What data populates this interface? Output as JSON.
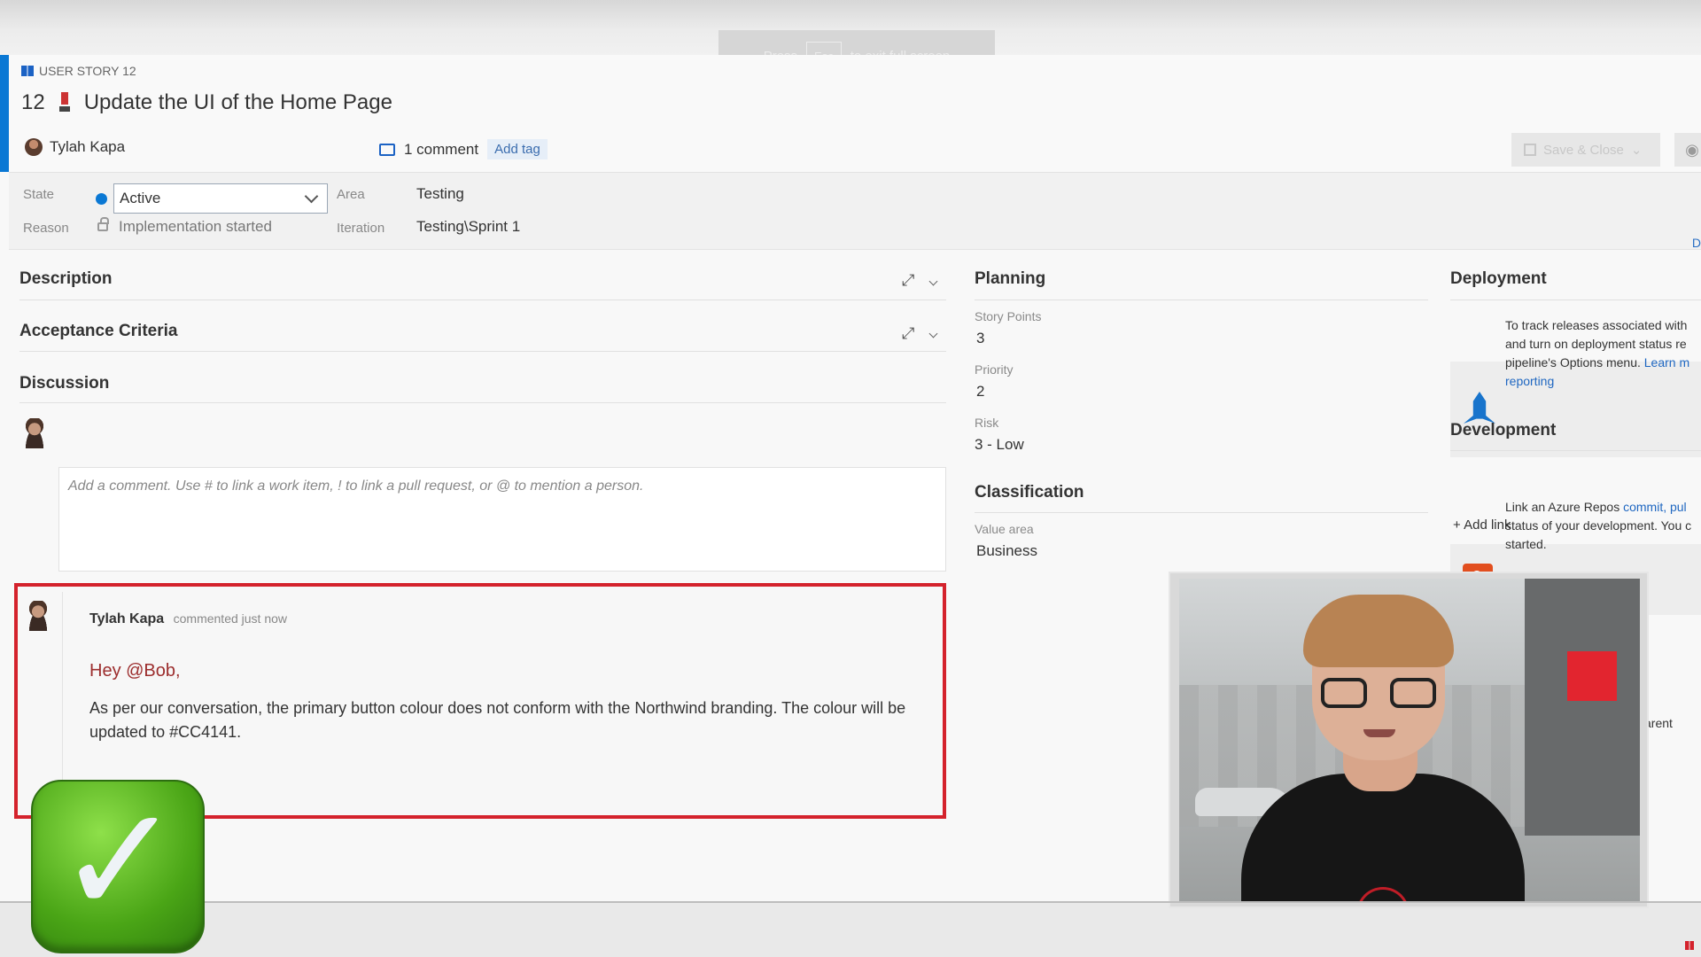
{
  "header": {
    "type_label": "USER STORY 12",
    "id": "12",
    "title": "Update the UI of the Home Page",
    "owner": "Tylah Kapa",
    "comment_count": "1 comment",
    "add_tag": "Add tag",
    "save_close": "Save & Close"
  },
  "fullscreen_toast": {
    "press": "Press",
    "key": "Esc",
    "rest": "to exit full screen"
  },
  "fields": {
    "state_label": "State",
    "state_value": "Active",
    "reason_label": "Reason",
    "reason_value": "Implementation started",
    "area_label": "Area",
    "area_value": "Testing",
    "iteration_label": "Iteration",
    "iteration_value": "Testing\\Sprint 1",
    "discussion_tab": "D"
  },
  "sections": {
    "description": "Description",
    "acceptance": "Acceptance Criteria",
    "discussion": "Discussion"
  },
  "discussion": {
    "placeholder": "Add a comment. Use # to link a work item, ! to link a pull request, or @ to mention a person.",
    "comment": {
      "author": "Tylah Kapa",
      "meta": "commented just now",
      "mention": "Hey @Bob,",
      "body": "As per our conversation, the primary button colour does not conform with the Northwind branding. The colour will be updated to #CC4141."
    }
  },
  "planning": {
    "title": "Planning",
    "story_points_label": "Story Points",
    "story_points": "3",
    "priority_label": "Priority",
    "priority": "2",
    "risk_label": "Risk",
    "risk": "3 - Low"
  },
  "classification": {
    "title": "Classification",
    "value_area_label": "Value area",
    "value_area": "Business"
  },
  "deployment": {
    "title": "Deployment",
    "line1": "To track releases associated with",
    "line2": "and turn on deployment status re",
    "line3": "pipeline's Options menu.",
    "link1": "Learn m",
    "link2": "reporting"
  },
  "development": {
    "title": "Development",
    "add_link": "Add link",
    "line1_prefix": "Link an Azure Repos",
    "line1_links": "commit, pul",
    "line2": "status of your development. You c",
    "line3": "started."
  },
  "related": {
    "parent_text": "arent"
  },
  "colors": {
    "accent": "#0a78d4",
    "highlight": "#d4222c",
    "mention": "#9c2d2d"
  }
}
